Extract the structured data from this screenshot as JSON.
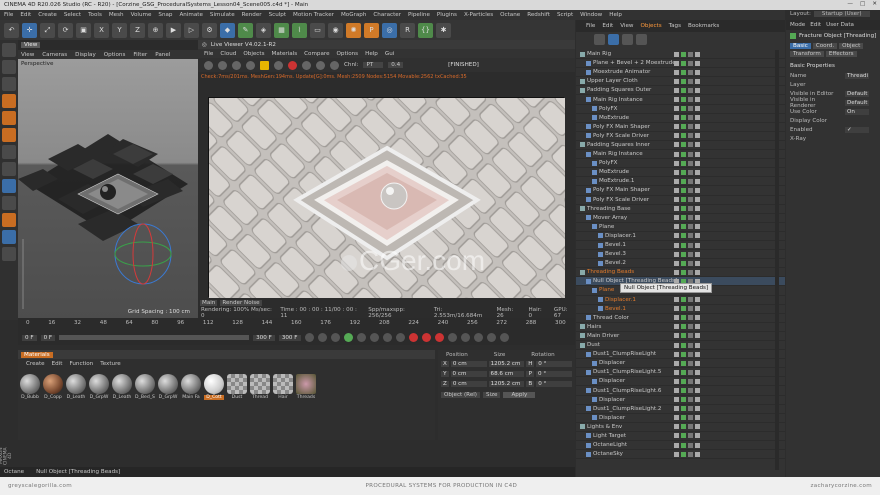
{
  "titlebar": {
    "title": "CINEMA 4D R20.026 Studio (RC - R20) - [Corzine_GSG_ProceduralSystems_Lesson04_Scene005.c4d *] - Main",
    "controls": [
      "—",
      "□",
      "✕"
    ]
  },
  "menu": [
    "File",
    "Edit",
    "Create",
    "Select",
    "Tools",
    "Mesh",
    "Volume",
    "Snap",
    "Animate",
    "Simulate",
    "Render",
    "Sculpt",
    "Motion Tracker",
    "MoGraph",
    "Character",
    "Pipeline",
    "Plugins",
    "X-Particles",
    "Octane",
    "Redshift",
    "Script",
    "Window",
    "Help"
  ],
  "layout": {
    "label": "Layout:",
    "value": "Startup (User)"
  },
  "toolbar": {
    "coords": [
      "X",
      "Y",
      "Z"
    ]
  },
  "viewport": {
    "tab": "View",
    "menu": [
      "View",
      "Cameras",
      "Display",
      "Options",
      "Filter",
      "Panel"
    ],
    "label": "Perspective",
    "grid": "Grid Spacing : 100 cm"
  },
  "uv": {
    "title": "Live Viewer V4.02.1-R2",
    "menu": [
      "File",
      "Cloud",
      "Objects",
      "Materials",
      "Compare",
      "Options",
      "Help",
      "Gui"
    ],
    "finished": "[FINISHED]",
    "channel_label": "Chnl:",
    "channel_value": "PT",
    "num": "0.4",
    "info": "Check:7ms/201ms. MeshGen:194ms. Update[G]:0ms. Mesh:2509 Nodes:5154 Movable:2562 txCached:35",
    "status_tabs": [
      "Main",
      "Render Noise"
    ],
    "stats": [
      "Rendering: 100%  Ms/sec: 0",
      "Time : 00 : 00 : 11/00 : 00 : 11",
      "Spp/maxspp: 256/256",
      "Tri: 2.553m/16.684m",
      "Mesh: 26",
      "Hair: 0",
      "GPU:  67"
    ]
  },
  "timeline": {
    "ticks": [
      "0",
      "16",
      "32",
      "48",
      "64",
      "80",
      "96",
      "112",
      "128",
      "144",
      "160",
      "176",
      "192",
      "208",
      "224",
      "240",
      "256",
      "272",
      "288",
      "300"
    ],
    "start": "0 F",
    "current": "0 F",
    "end": "300 F",
    "end2": "300 F"
  },
  "materials": {
    "tab": "Materials",
    "menu": [
      "Create",
      "Edit",
      "Function",
      "Texture"
    ],
    "items": [
      {
        "label": "D_Bubb",
        "style": "ball"
      },
      {
        "label": "D_Copp",
        "style": "brown"
      },
      {
        "label": "D_Leath",
        "style": "ball"
      },
      {
        "label": "D_GrpW",
        "style": "ball"
      },
      {
        "label": "D_Leath",
        "style": "ball"
      },
      {
        "label": "D_Bed_S",
        "style": "ball"
      },
      {
        "label": "D_GrpW",
        "style": "ball"
      },
      {
        "label": "Main Fa",
        "style": "ball"
      },
      {
        "label": "D_Cott",
        "style": "sel",
        "active": true
      },
      {
        "label": "Dust",
        "style": "chk"
      },
      {
        "label": "Thread",
        "style": "chk"
      },
      {
        "label": "Hair",
        "style": "chk"
      },
      {
        "label": "Threads",
        "style": "thr"
      }
    ]
  },
  "coordinates": {
    "headers": [
      "Position",
      "Size",
      "Rotation"
    ],
    "rows": [
      {
        "axis": "X",
        "pos": "0 cm",
        "size": "1205.2 cm",
        "rl": "H",
        "rot": "0 °"
      },
      {
        "axis": "Y",
        "pos": "0 cm",
        "size": "68.6 cm",
        "rl": "P",
        "rot": "0 °"
      },
      {
        "axis": "Z",
        "pos": "0 cm",
        "size": "1205.2 cm",
        "rl": "B",
        "rot": "0 °"
      }
    ],
    "mode": "Object (Rel)",
    "size_mode": "Size",
    "apply": "Apply"
  },
  "logo": "MAXON\nCINEMA 4D",
  "status": {
    "renderer": "Octane",
    "object": "Null Object [Threading Beads]"
  },
  "footer": {
    "left": "greyscalegorilla.com",
    "center": "PROCEDURAL SYSTEMS FOR PRODUCTION IN C4D",
    "right": "zacharycorzine.com"
  },
  "objects": {
    "tabs": [
      "File",
      "Edit",
      "View",
      "Objects",
      "Tags",
      "Bookmarks"
    ],
    "rows": [
      {
        "n": "Main Rig",
        "d": 0
      },
      {
        "n": "Plane + Bevel + 2 Moextrude",
        "d": 1
      },
      {
        "n": "Moextrude Animator",
        "d": 1
      },
      {
        "n": "Upper Layer Cloth",
        "d": 0
      },
      {
        "n": "Padding Squares Outer",
        "d": 0
      },
      {
        "n": "Main Rig Instance",
        "d": 1
      },
      {
        "n": "PolyFX",
        "d": 2
      },
      {
        "n": "MoExtrude",
        "d": 2
      },
      {
        "n": "Poly FX Main Shaper",
        "d": 1
      },
      {
        "n": "Poly FX Scale Driver",
        "d": 1
      },
      {
        "n": "Padding Squares Inner",
        "d": 0
      },
      {
        "n": "Main Rig Instance",
        "d": 1
      },
      {
        "n": "PolyFX",
        "d": 2
      },
      {
        "n": "MoExtrude",
        "d": 2
      },
      {
        "n": "MoExtrude.1",
        "d": 2
      },
      {
        "n": "Poly FX Main Shaper",
        "d": 1
      },
      {
        "n": "Poly FX Scale Driver",
        "d": 1
      },
      {
        "n": "Threading Base",
        "d": 0
      },
      {
        "n": "Mover Array",
        "d": 1
      },
      {
        "n": "Plane",
        "d": 2
      },
      {
        "n": "Displacer.1",
        "d": 3
      },
      {
        "n": "Bevel.1",
        "d": 3
      },
      {
        "n": "Bevel.3",
        "d": 3
      },
      {
        "n": "Bevel.2",
        "d": 3
      },
      {
        "n": "Threading Beads",
        "d": 0,
        "hl": true
      },
      {
        "n": "Null Object [Threading Beads]",
        "d": 1,
        "sel": true
      },
      {
        "n": "Plane",
        "d": 2,
        "hl": true
      },
      {
        "n": "Displacer.1",
        "d": 3,
        "hl": true
      },
      {
        "n": "Bevel.1",
        "d": 3,
        "hl": true
      },
      {
        "n": "Thread Color",
        "d": 1
      },
      {
        "n": "Hairs",
        "d": 0
      },
      {
        "n": "Main Driver",
        "d": 0
      },
      {
        "n": "Dust",
        "d": 0
      },
      {
        "n": "Dust1_ClumpRiseLight",
        "d": 1
      },
      {
        "n": "Displacer",
        "d": 2
      },
      {
        "n": "Dust1_ClumpRiseLight.5",
        "d": 1
      },
      {
        "n": "Displacer",
        "d": 2
      },
      {
        "n": "Dust1_ClumpRiseLight.6",
        "d": 1
      },
      {
        "n": "Displacer",
        "d": 2
      },
      {
        "n": "Dust1_ClumpRiseLight.2",
        "d": 1
      },
      {
        "n": "Displacer",
        "d": 2
      },
      {
        "n": "Lights & Env",
        "d": 0
      },
      {
        "n": "Light Target",
        "d": 1
      },
      {
        "n": "OctaneLight",
        "d": 1
      },
      {
        "n": "OctaneSky",
        "d": 1
      }
    ]
  },
  "tooltip": "Null Object [Threading Beads]",
  "attributes": {
    "menu": [
      "Mode",
      "Edit",
      "User Data"
    ],
    "title": "Fracture Object [Threading]",
    "tabs": [
      "Basic",
      "Coord.",
      "Object",
      "Transform",
      "Effectors"
    ],
    "section": "Basic Properties",
    "props": [
      {
        "l": "Name",
        "v": "Threadi"
      },
      {
        "l": "Layer",
        "v": ""
      },
      {
        "l": "Visible in Editor",
        "v": "Default"
      },
      {
        "l": "Visible in Renderer",
        "v": "Default"
      },
      {
        "l": "Use Color",
        "v": "On"
      },
      {
        "l": "Display Color",
        "v": ""
      },
      {
        "l": "Enabled",
        "v": "✓"
      },
      {
        "l": "X-Ray",
        "v": ""
      }
    ]
  }
}
